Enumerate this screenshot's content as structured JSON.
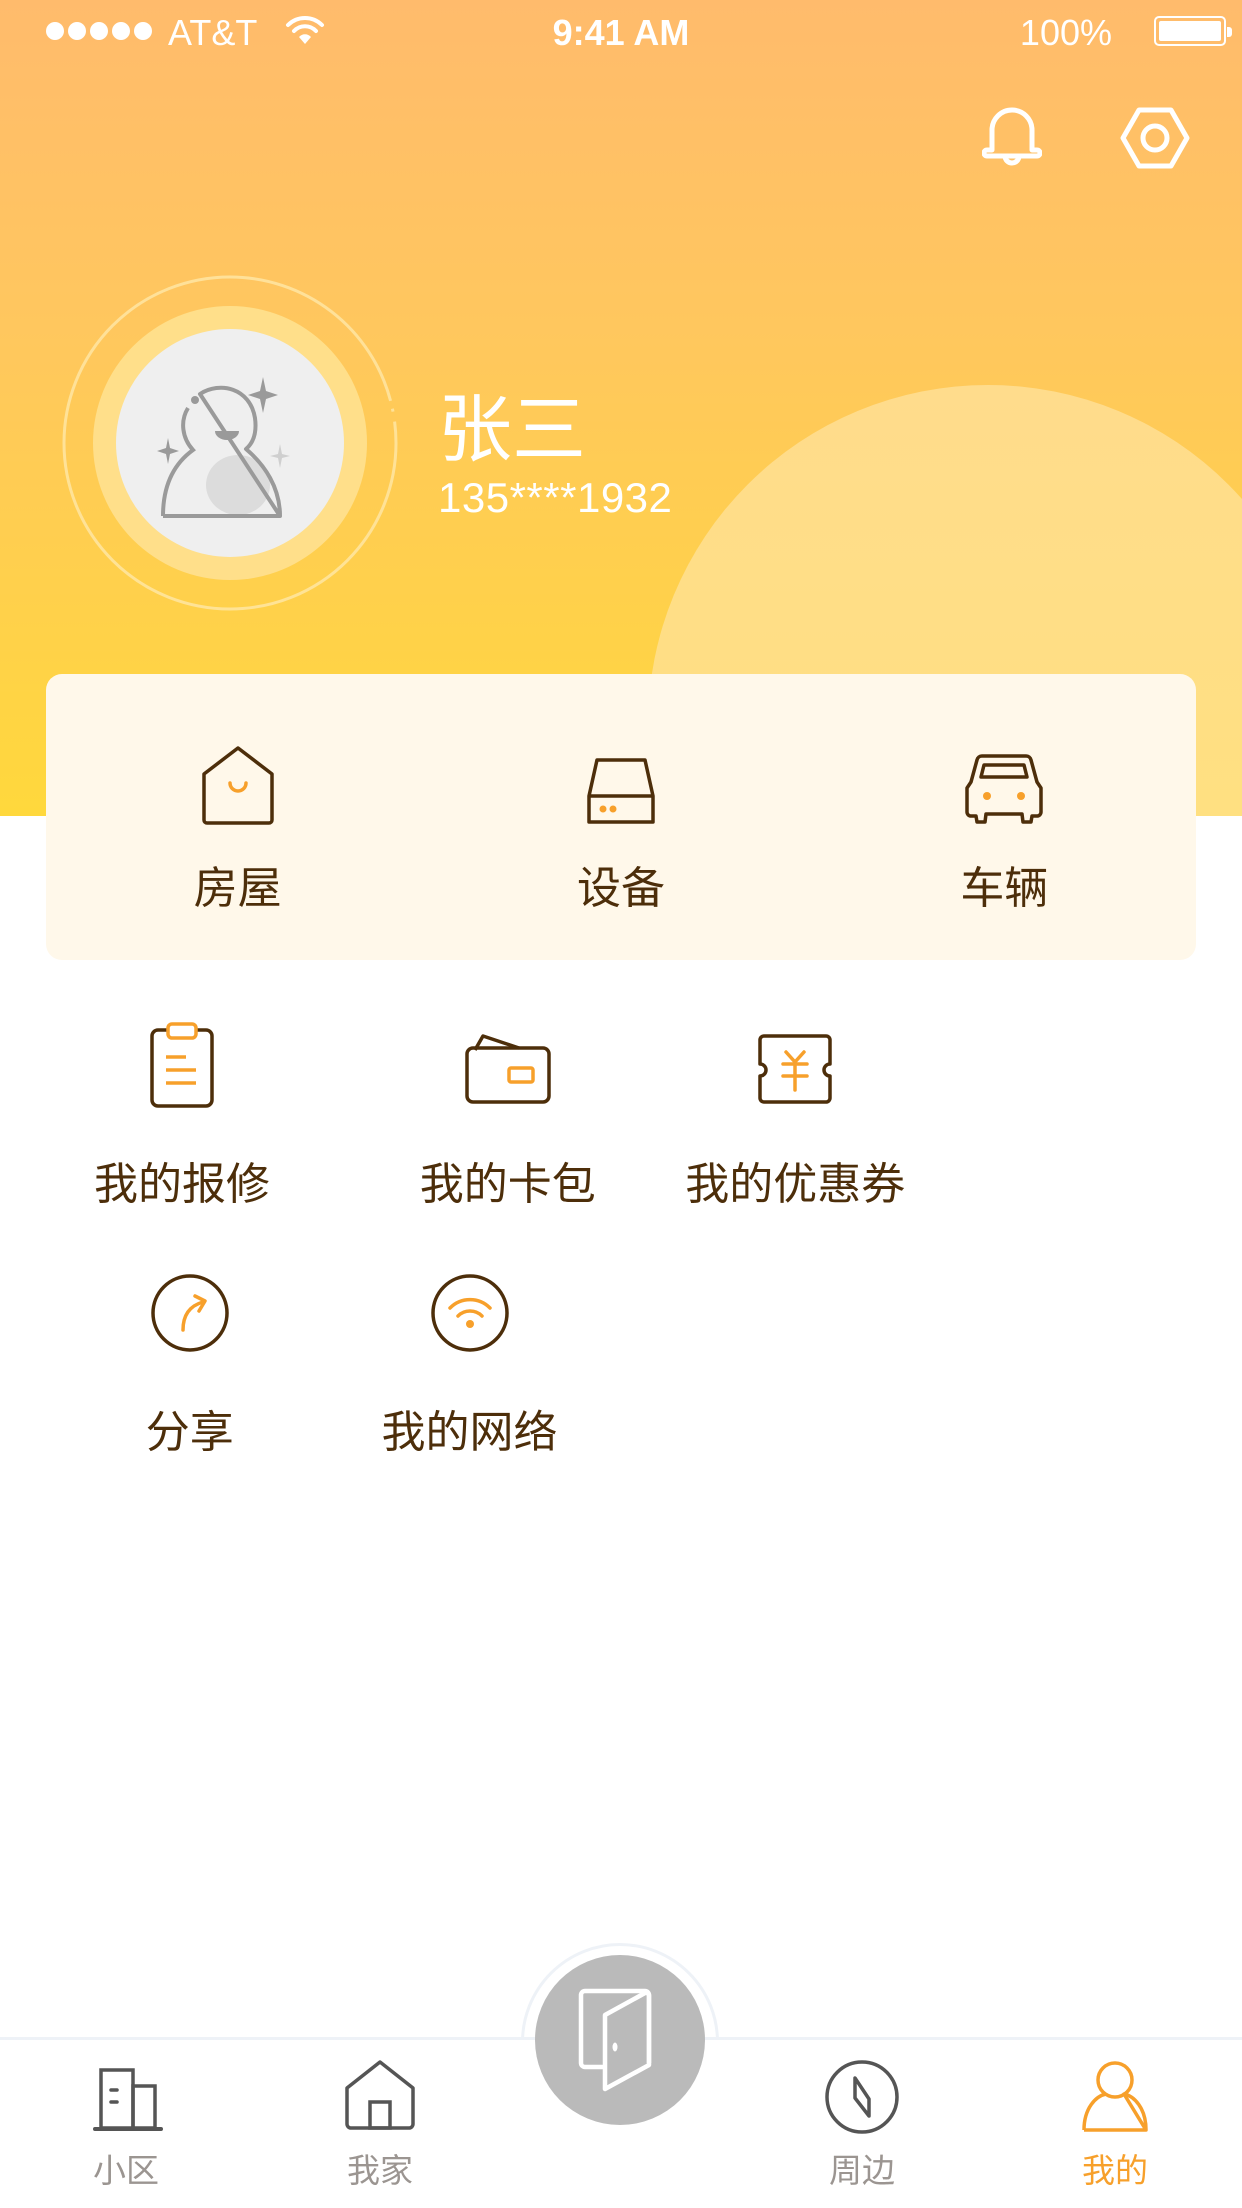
{
  "status_bar": {
    "carrier": "AT&T",
    "time": "9:41 AM",
    "battery": "100%"
  },
  "header": {
    "notification_icon": "bell-icon",
    "settings_icon": "gear-icon"
  },
  "profile": {
    "name": "张三",
    "phone": "135****1932",
    "avatar_icon": "default-avatar-icon"
  },
  "quick_actions": [
    {
      "label": "房屋",
      "icon": "house-icon"
    },
    {
      "label": "设备",
      "icon": "device-icon"
    },
    {
      "label": "车辆",
      "icon": "car-icon"
    }
  ],
  "services": [
    {
      "label": "我的报修",
      "icon": "clipboard-icon"
    },
    {
      "label": "我的卡包",
      "icon": "wallet-icon"
    },
    {
      "label": "我的优惠券",
      "icon": "coupon-icon"
    },
    {
      "label": "分享",
      "icon": "share-icon"
    },
    {
      "label": "我的网络",
      "icon": "wifi-icon"
    }
  ],
  "tab_bar": {
    "tabs": [
      {
        "label": "小区",
        "icon": "building-icon",
        "active": false
      },
      {
        "label": "我家",
        "icon": "home-icon",
        "active": false
      },
      {
        "label": "周边",
        "icon": "compass-icon",
        "active": false
      },
      {
        "label": "我的",
        "icon": "person-icon",
        "active": true
      }
    ],
    "center_icon": "door-icon"
  },
  "colors": {
    "header_top": "#ffbb6c",
    "header_bottom": "#ffd83c",
    "accent": "#f7a02b",
    "text_dark": "#4d2e0a",
    "tab_inactive": "#9b9591",
    "card_bg": "#fff8ea"
  }
}
